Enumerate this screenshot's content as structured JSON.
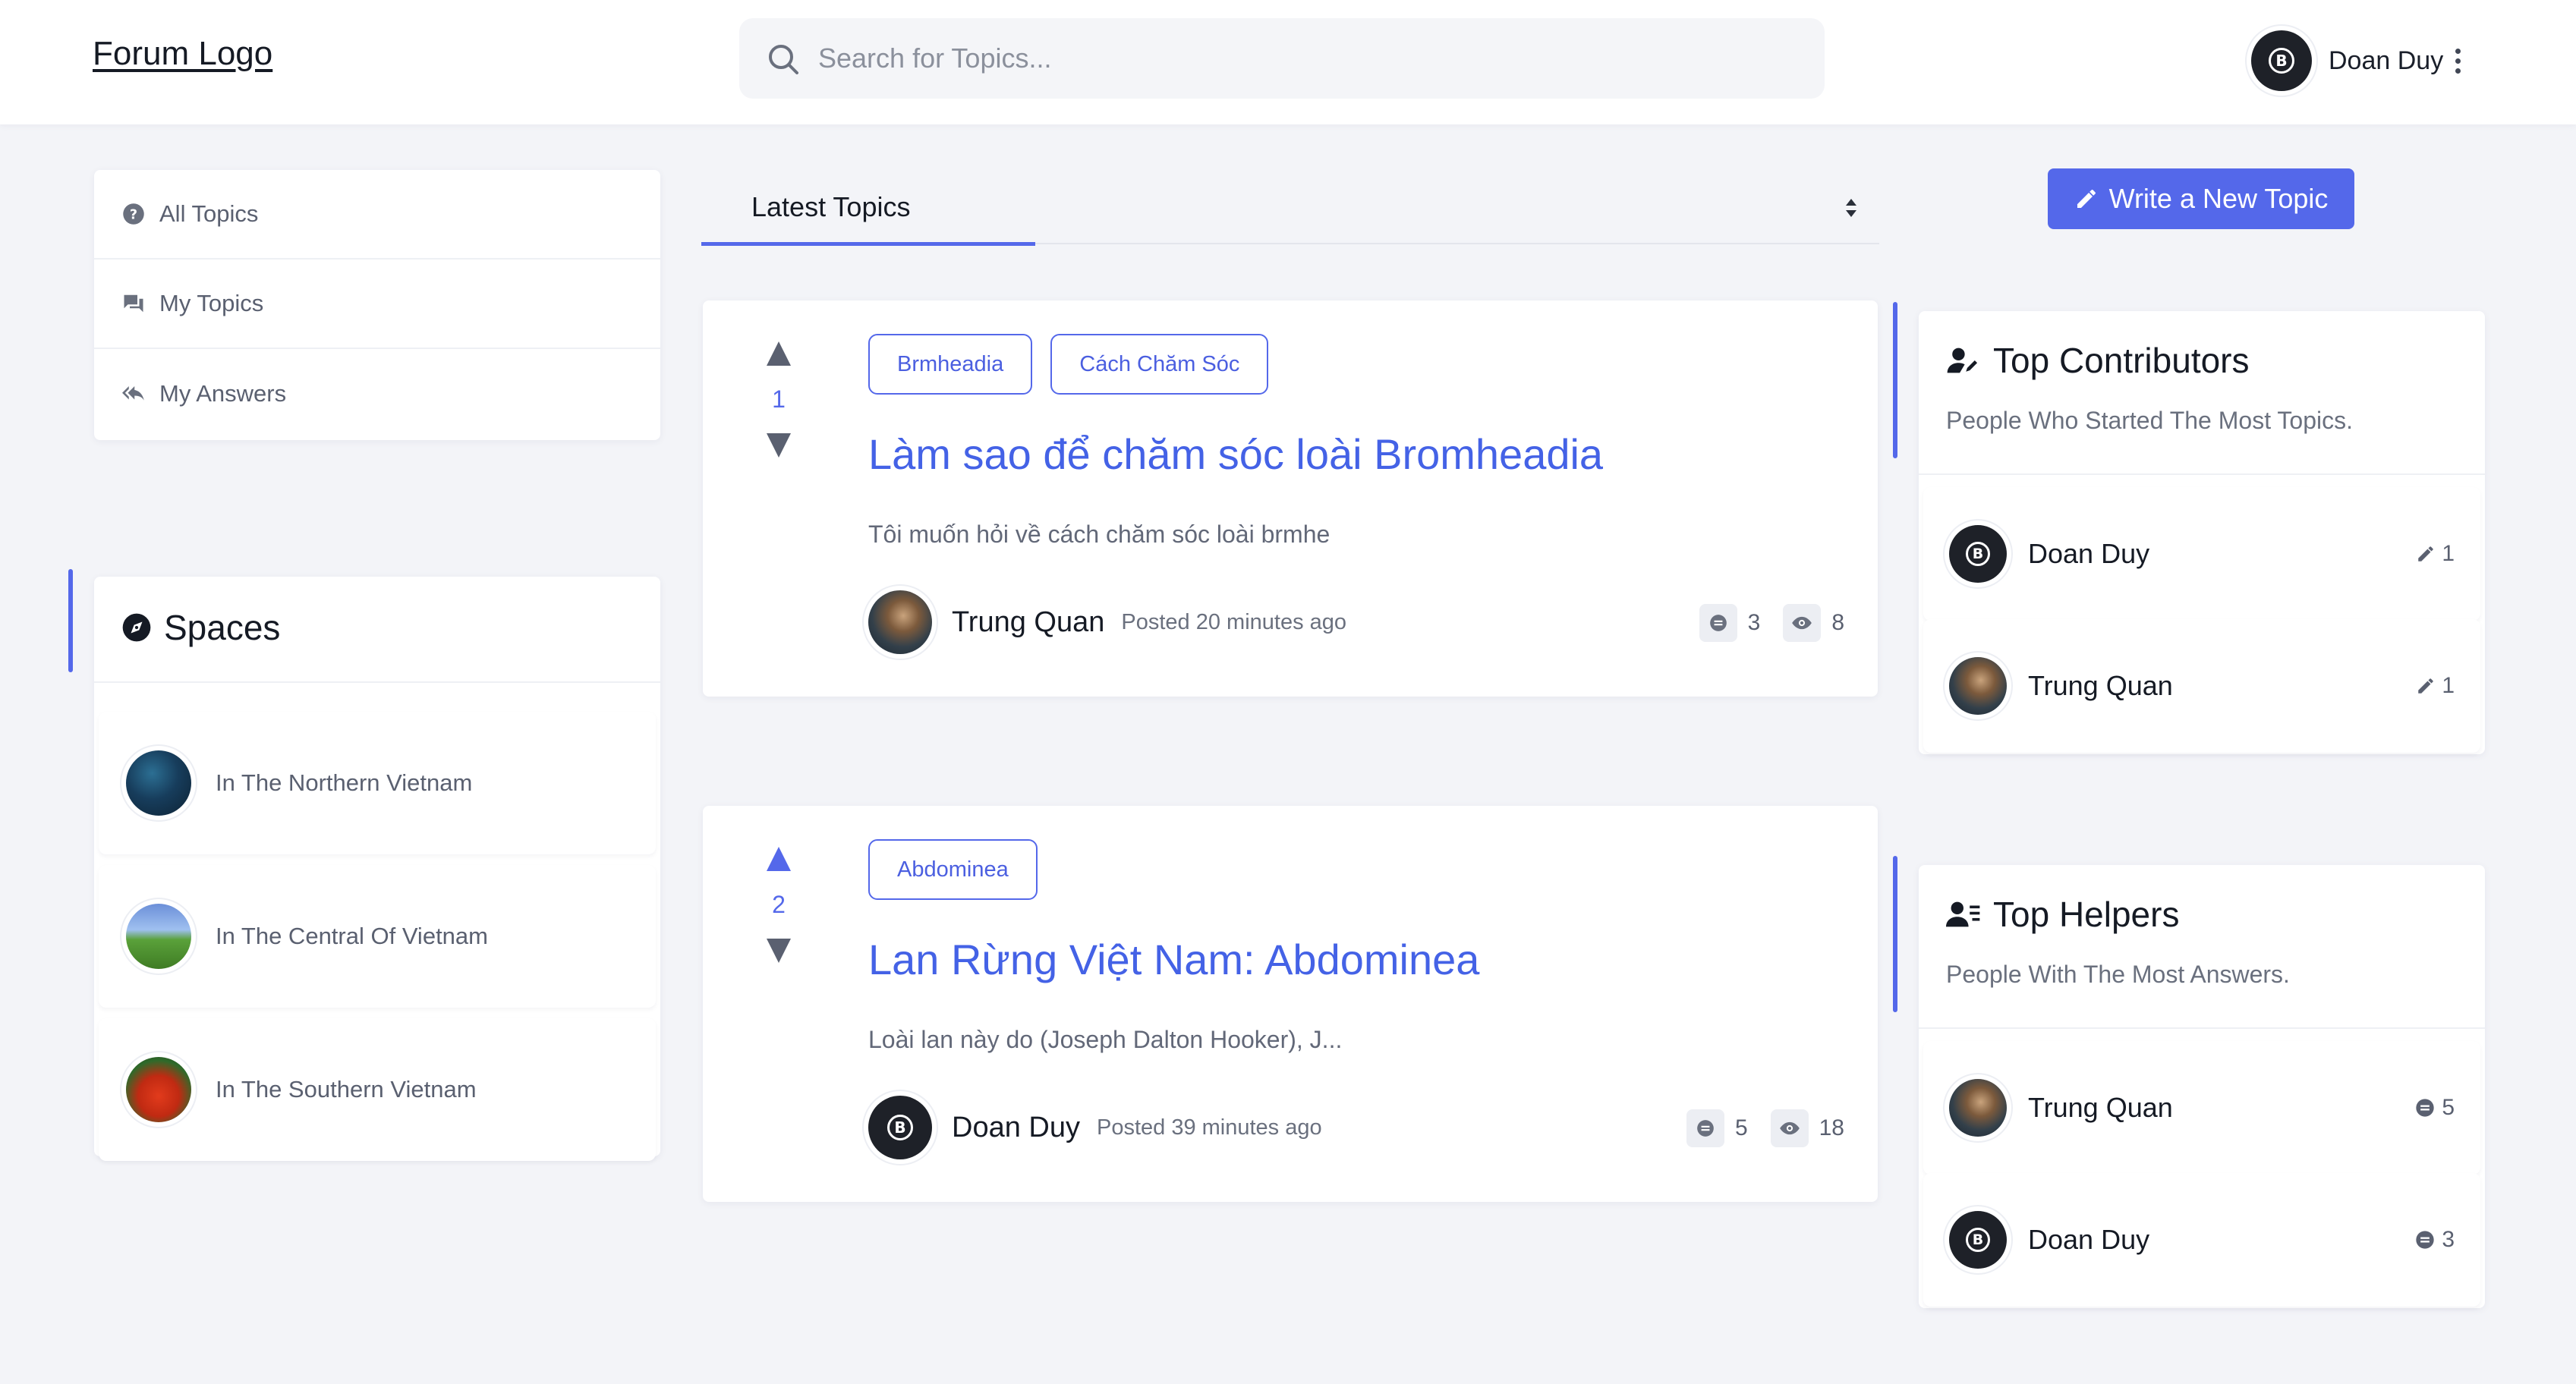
{
  "header": {
    "logo": "Forum Logo",
    "search_placeholder": "Search for Topics...",
    "user_name": "Doan Duy"
  },
  "nav": {
    "items": [
      {
        "label": "All Topics",
        "icon": "question-circle-icon"
      },
      {
        "label": "My Topics",
        "icon": "chat-bubbles-icon"
      },
      {
        "label": "My Answers",
        "icon": "reply-all-icon"
      }
    ]
  },
  "spaces": {
    "title": "Spaces",
    "items": [
      {
        "name": "In The Northern Vietnam"
      },
      {
        "name": "In The Central Of Vietnam"
      },
      {
        "name": "In The Southern Vietnam"
      }
    ]
  },
  "topics_header": {
    "tab_label": "Latest Topics"
  },
  "topics": [
    {
      "votes": "1",
      "tags": [
        "Brmheadia",
        "Cách Chăm Sóc"
      ],
      "title": "Làm sao để chăm sóc loài Bromheadia",
      "excerpt": "Tôi muốn hỏi về cách chăm sóc loài brmhe",
      "author": "Trung Quan",
      "posted": "Posted 20 minutes ago",
      "comments": "3",
      "views": "8"
    },
    {
      "votes": "2",
      "tags": [
        "Abdominea"
      ],
      "title": "Lan Rừng Việt Nam: Abdominea",
      "excerpt": "Loài lan này do (Joseph Dalton Hooker), J...",
      "author": "Doan Duy",
      "posted": "Posted 39 minutes ago",
      "comments": "5",
      "views": "18"
    }
  ],
  "write_button": "Write a New Topic",
  "top_contributors": {
    "title": "Top Contributors",
    "subtitle": "People Who Started The Most Topics.",
    "items": [
      {
        "name": "Doan Duy",
        "count": "1"
      },
      {
        "name": "Trung Quan",
        "count": "1"
      }
    ]
  },
  "top_helpers": {
    "title": "Top Helpers",
    "subtitle": "People With The Most Answers.",
    "items": [
      {
        "name": "Trung Quan",
        "count": "5"
      },
      {
        "name": "Doan Duy",
        "count": "3"
      }
    ]
  },
  "colors": {
    "accent": "#5468ea",
    "link": "#4462e6",
    "background": "#f3f4f8"
  }
}
